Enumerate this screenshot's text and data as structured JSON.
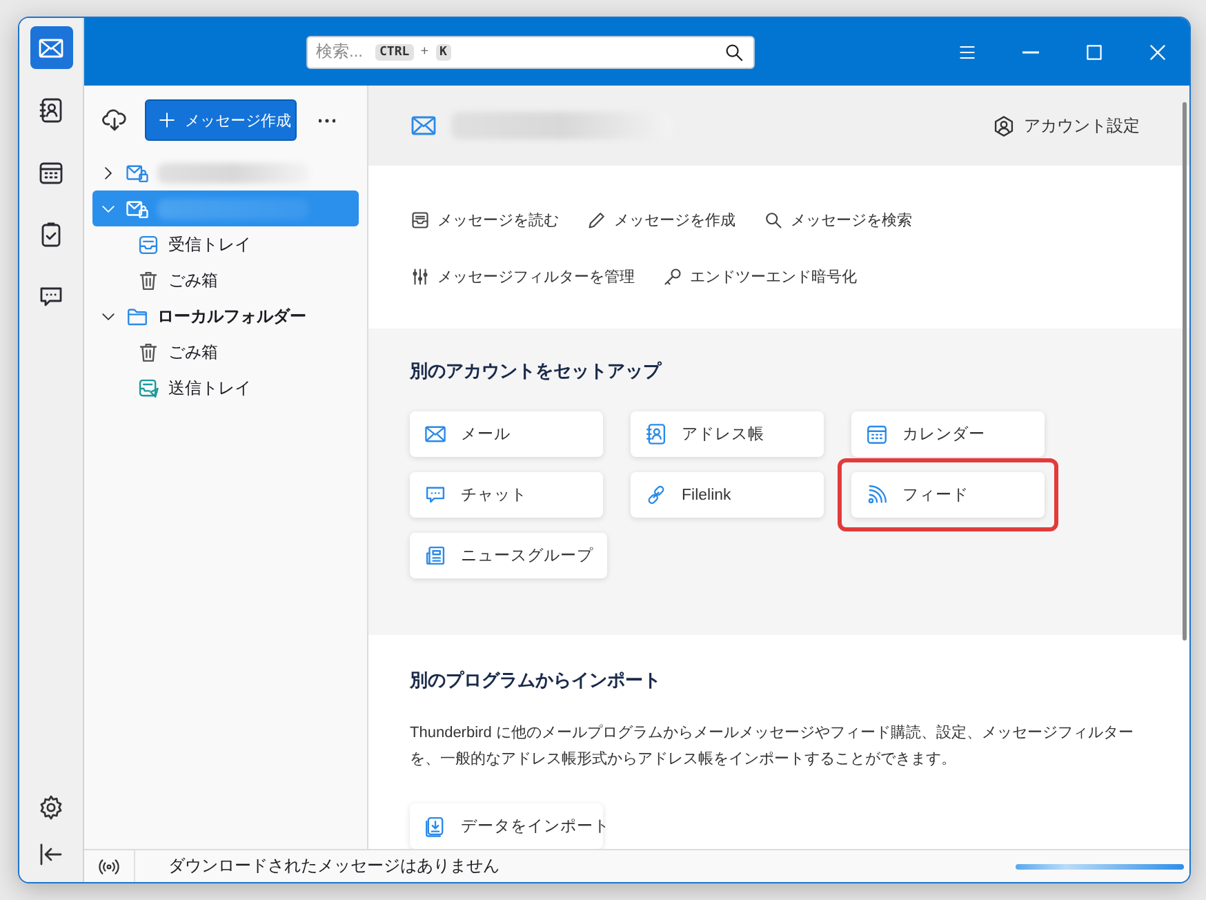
{
  "spaces": [
    {
      "kind": "mail",
      "selected": true
    },
    {
      "kind": "addressbook",
      "selected": false
    },
    {
      "kind": "calendar",
      "selected": false
    },
    {
      "kind": "tasks",
      "selected": false
    },
    {
      "kind": "chat",
      "selected": false
    }
  ],
  "search": {
    "placeholder": "検索...",
    "shortcut_keys": [
      "CTRL",
      "K"
    ],
    "shortcut_joiner": "+"
  },
  "folder_pane": {
    "compose_button": "メッセージ作成",
    "tree": [
      {
        "kind": "account",
        "expanded": false,
        "selected": false
      },
      {
        "kind": "account",
        "expanded": true,
        "selected": true,
        "children": [
          {
            "kind": "inbox",
            "label": "受信トレイ",
            "selected": false
          },
          {
            "kind": "trash",
            "label": "ごみ箱",
            "selected": false
          }
        ]
      },
      {
        "kind": "local",
        "label": "ローカルフォルダー",
        "expanded": true,
        "selected": false,
        "children": [
          {
            "kind": "trash",
            "label": "ごみ箱",
            "selected": false
          },
          {
            "kind": "outbox",
            "label": "送信トレイ",
            "selected": false
          }
        ]
      }
    ]
  },
  "account_header": {
    "settings_button": "アカウント設定"
  },
  "actions": [
    {
      "kind": "read",
      "label": "メッセージを読む"
    },
    {
      "kind": "compose",
      "label": "メッセージを作成"
    },
    {
      "kind": "search",
      "label": "メッセージを検索"
    },
    {
      "kind": "filters",
      "label": "メッセージフィルターを管理"
    },
    {
      "kind": "key",
      "label": "エンドツーエンド暗号化"
    }
  ],
  "setup": {
    "title": "別のアカウントをセットアップ",
    "items": [
      {
        "kind": "mail",
        "label": "メール",
        "highlighted": false
      },
      {
        "kind": "addressbook",
        "label": "アドレス帳",
        "highlighted": false
      },
      {
        "kind": "calendar",
        "label": "カレンダー",
        "highlighted": false
      },
      {
        "kind": "chat",
        "label": "チャット",
        "highlighted": false
      },
      {
        "kind": "filelink",
        "label": "Filelink",
        "highlighted": false
      },
      {
        "kind": "feed",
        "label": "フィード",
        "highlighted": true
      },
      {
        "kind": "newsgroup",
        "label": "ニュースグループ",
        "highlighted": false
      }
    ]
  },
  "import": {
    "title": "別のプログラムからインポート",
    "description": "Thunderbird に他のメールプログラムからメールメッセージやフィード購読、設定、メッセージフィルターを、一般的なアドレス帳形式からアドレス帳をインポートすることができます。",
    "button": "データをインポート"
  },
  "status_bar": {
    "text": "ダウンロードされたメッセージはありません"
  }
}
